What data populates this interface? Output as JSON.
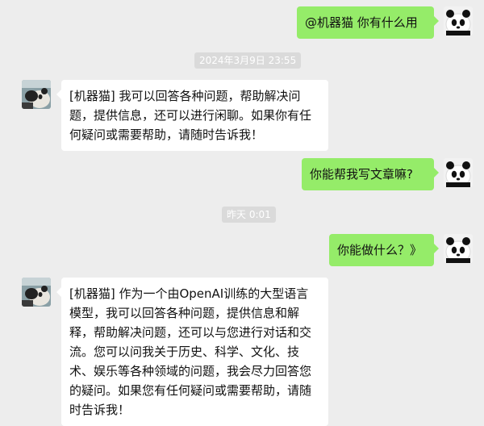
{
  "messages": [
    {
      "side": "right",
      "text": "@机器猫 你有什么用",
      "avatar_icon": "panda-avatar-icon"
    },
    {
      "timestamp": "2024年3月9日 23:55"
    },
    {
      "side": "left",
      "text": "[机器猫] 我可以回答各种问题，帮助解决问题，提供信息，还可以进行闲聊。如果你有任何疑问或需要帮助，请随时告诉我！",
      "avatar_icon": "panda-photo-avatar-icon"
    },
    {
      "side": "right",
      "text": "你能帮我写文章嘛?",
      "avatar_icon": "panda-avatar-icon"
    },
    {
      "timestamp": "昨天 0:01"
    },
    {
      "side": "right",
      "text": "你能做什么？》",
      "avatar_icon": "panda-avatar-icon"
    },
    {
      "side": "left",
      "text": "[机器猫] 作为一个由OpenAI训练的大型语言模型，我可以回答各种问题，提供信息和解释，帮助解决问题，还可以与您进行对话和交流。您可以问我关于历史、科学、文化、技术、娱乐等各种领域的问题，我会尽力回答您的疑问。如果您有任何疑问或需要帮助，请随时告诉我！",
      "avatar_icon": "panda-photo-avatar-icon"
    }
  ],
  "colors": {
    "background": "#ededed",
    "bubble_self": "#95ec69",
    "bubble_other": "#ffffff",
    "timestamp_bg": "#dadada"
  }
}
